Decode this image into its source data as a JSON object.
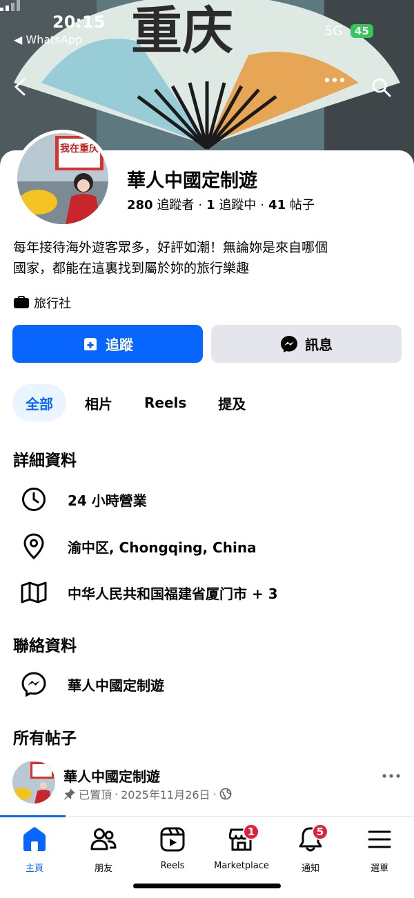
{
  "status_bar": {
    "time": "20:15",
    "back_app": "◀ WhatsApp",
    "network": "5G",
    "battery": "45"
  },
  "cover": {
    "text": "重庆"
  },
  "profile": {
    "name": "華人中國定制遊",
    "followers_count": "280",
    "followers_label": "追蹤者",
    "following_count": "1",
    "following_label": "追蹤中",
    "posts_count": "41",
    "posts_label": "帖子",
    "bio_line1": "每年接待海外遊客眾多，好評如潮！無論妳是來自哪個",
    "bio_line2": "國家，都能在這裏找到屬於妳的旅行樂趣",
    "category": "旅行社",
    "avatar_sign": "我在重庆"
  },
  "actions": {
    "follow": "追蹤",
    "message": "訊息"
  },
  "tabs": [
    {
      "label": "全部"
    },
    {
      "label": "相片"
    },
    {
      "label": "Reels"
    },
    {
      "label": "提及"
    }
  ],
  "details": {
    "title": "詳細資料",
    "hours": "24 小時營業",
    "location": "渝中区, Chongqing, China",
    "area": "中华人民共和国福建省厦门市 + 3"
  },
  "contact": {
    "title": "聯絡資料",
    "messenger": "華人中國定制遊"
  },
  "posts": {
    "title": "所有帖子",
    "author": "華人中國定制遊",
    "pinned": "已置頂",
    "date": "2025年11月26日",
    "sep": "·"
  },
  "bottom_nav": [
    {
      "label": "主頁",
      "icon": "home-icon"
    },
    {
      "label": "朋友",
      "icon": "friends-icon"
    },
    {
      "label": "Reels",
      "icon": "reels-icon"
    },
    {
      "label": "Marketplace",
      "icon": "marketplace-icon",
      "badge": "1"
    },
    {
      "label": "通知",
      "icon": "bell-icon",
      "badge": "5"
    },
    {
      "label": "選單",
      "icon": "menu-icon"
    }
  ],
  "colors": {
    "primary": "#0866ff",
    "badge": "#e41e3f",
    "secondary_button": "#e4e6eb"
  }
}
